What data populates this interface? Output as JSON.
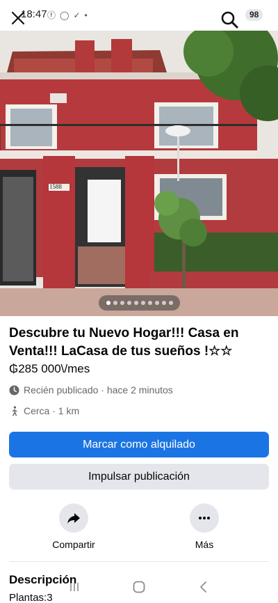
{
  "status_bar": {
    "time": "18:47",
    "battery": "98"
  },
  "photo": {
    "house_number": "1588",
    "slide_count": 10,
    "active_slide": 1
  },
  "listing": {
    "title": "Descubre  tu Nuevo  Hogar!!! Casa en Venta!!! LaCasa de tus sueños !☆☆",
    "price": "₲285 000\\/mes",
    "posted": "Recién publicado · hace 2 minutos",
    "distance": "Cerca · 1 km"
  },
  "buttons": {
    "primary": "Marcar como alquilado",
    "secondary": "Impulsar publicación"
  },
  "actions": {
    "share": "Compartir",
    "more": "Más"
  },
  "description": {
    "heading": "Descripción",
    "first_line": "Plantas:3"
  },
  "colors": {
    "primary": "#1b74e4",
    "secondary_bg": "#e4e6eb",
    "meta_text": "#65676b"
  },
  "icons": {
    "close": "close-icon",
    "search": "search-icon",
    "clock": "clock-icon",
    "walk": "walking-person-icon",
    "share": "share-arrow-icon",
    "more": "more-dots-icon"
  }
}
